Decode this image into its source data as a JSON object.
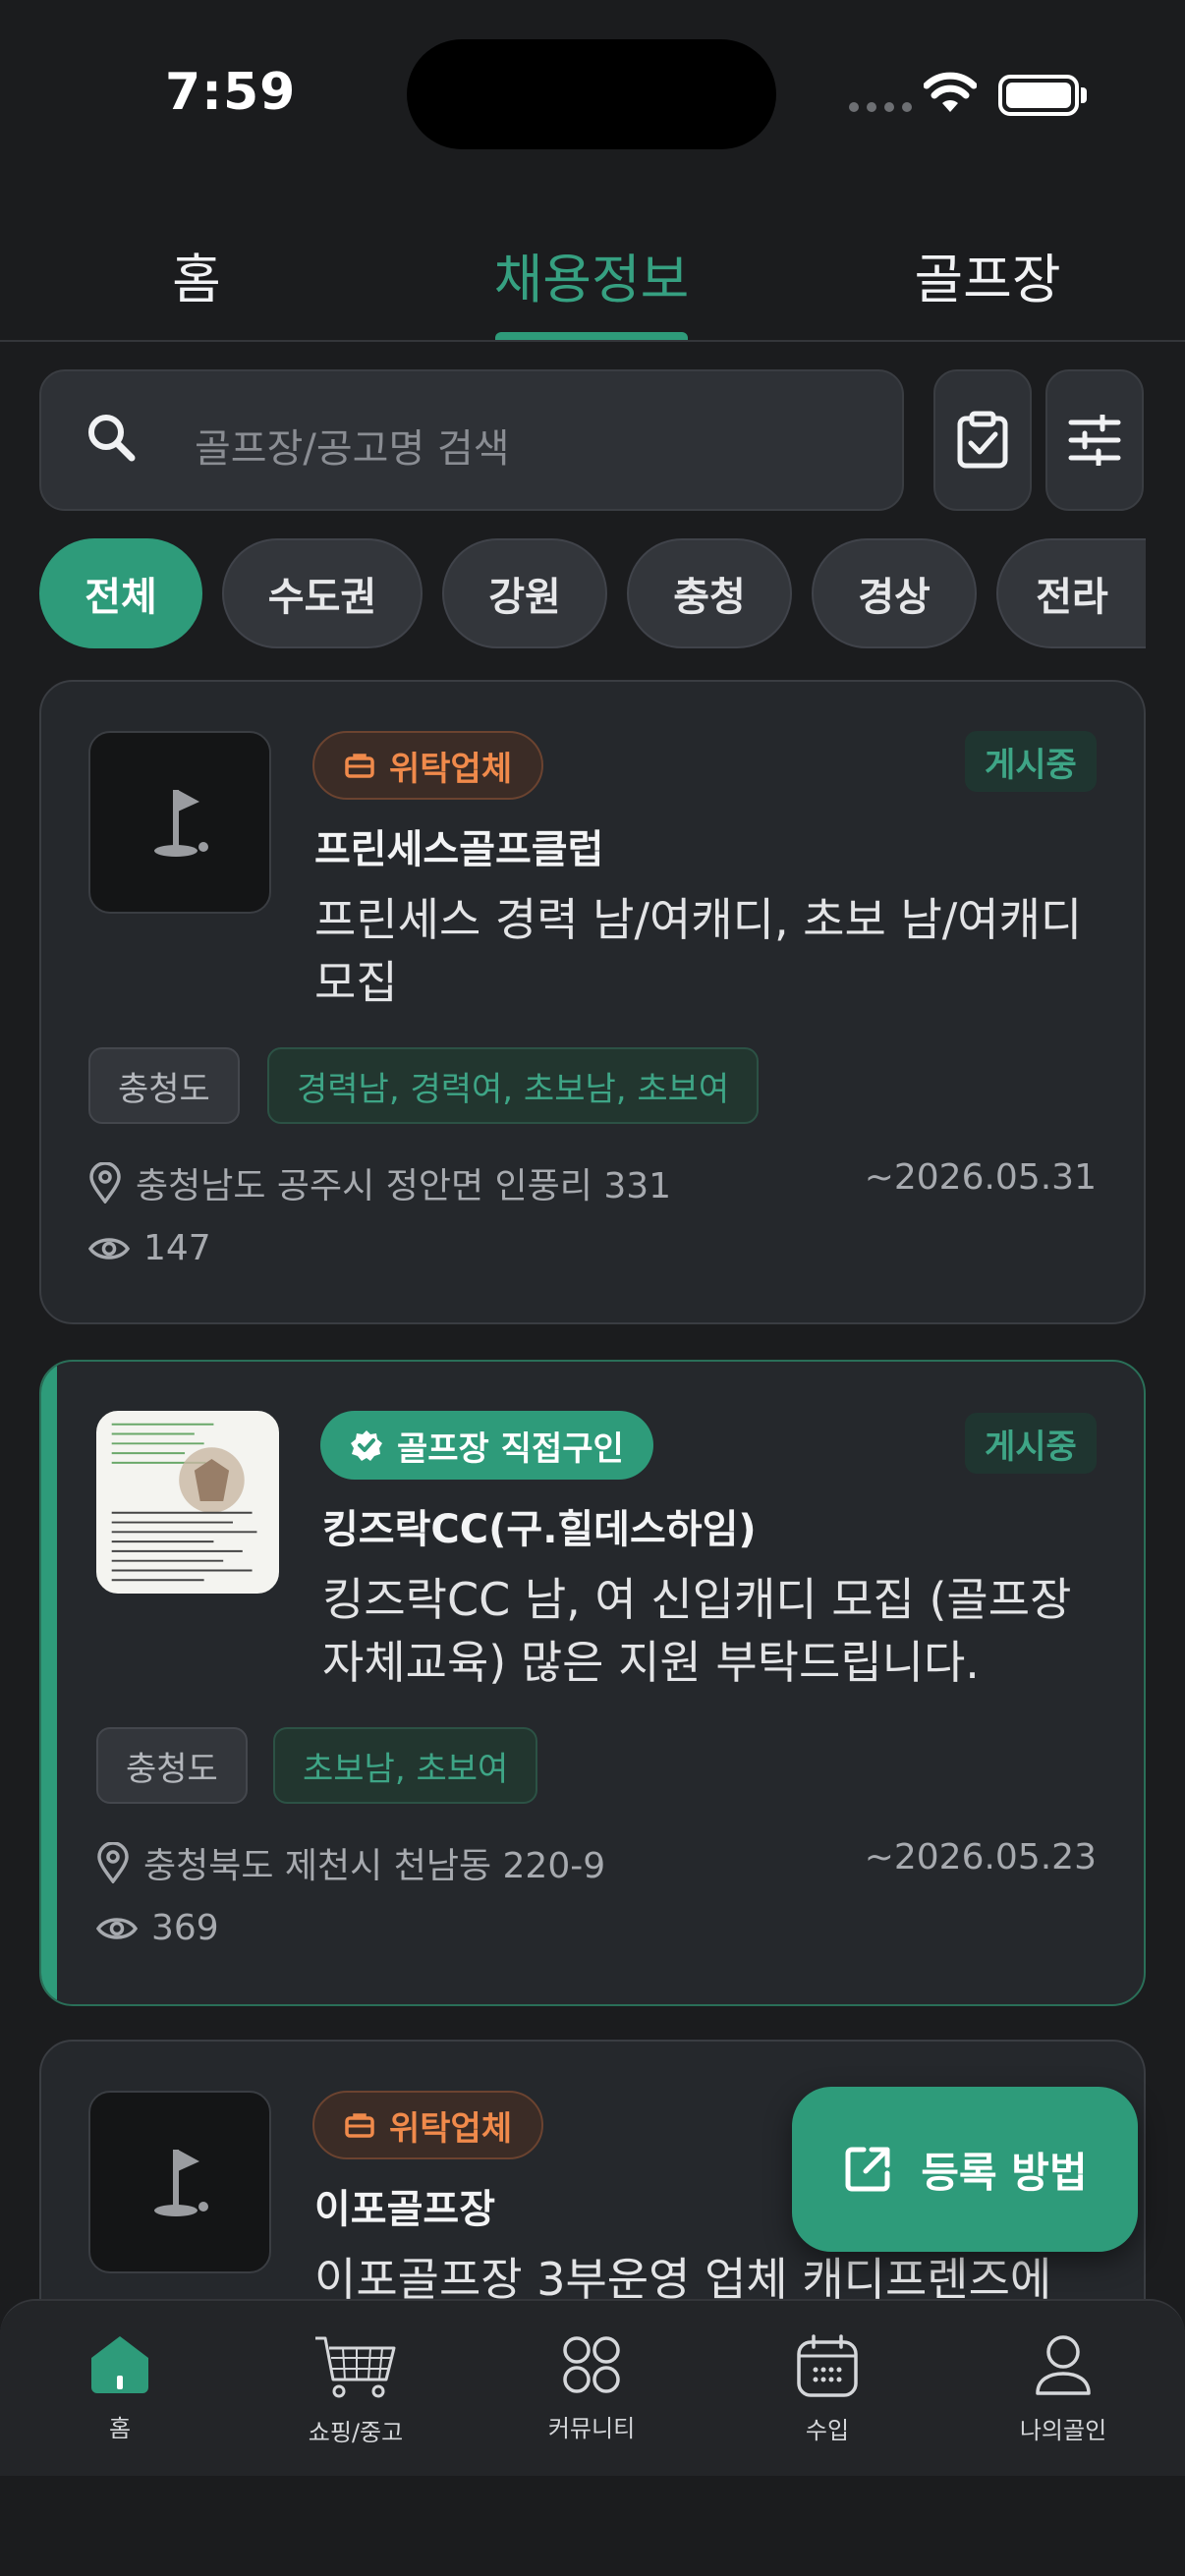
{
  "status_bar": {
    "time": "7:59"
  },
  "top_tabs": [
    {
      "label": "홈",
      "active": false
    },
    {
      "label": "채용정보",
      "active": true
    },
    {
      "label": "골프장",
      "active": false
    }
  ],
  "search": {
    "placeholder": "골프장/공고명 검색"
  },
  "region_chips": [
    {
      "label": "전체",
      "active": true
    },
    {
      "label": "수도권",
      "active": false
    },
    {
      "label": "강원",
      "active": false
    },
    {
      "label": "충청",
      "active": false
    },
    {
      "label": "경상",
      "active": false
    },
    {
      "label": "전라",
      "active": false
    }
  ],
  "cards": [
    {
      "type_badge": "위탁업체",
      "status": "게시중",
      "club_name": "프린세스골프클럽",
      "title_line1": "프린세스 경력 남/여캐디, 초보 남/여캐디",
      "title_line2": "모집",
      "region_tag": "충청도",
      "types_tag": "경력남, 경력여, 초보남, 초보여",
      "address": "충청남도 공주시 정안면 인풍리 331",
      "deadline": "~2026.05.31",
      "views": "147"
    },
    {
      "type_badge": "골프장 직접구인",
      "status": "게시중",
      "club_name": "킹즈락CC(구.힐데스하임)",
      "title_line1": "킹즈락CC 남, 여 신입캐디 모집 (골프장",
      "title_line2": "자체교육) 많은 지원 부탁드립니다.",
      "region_tag": "충청도",
      "types_tag": "초보남, 초보여",
      "address": "충청북도 제천시 천남동 220-9",
      "deadline": "~2026.05.23",
      "views": "369"
    },
    {
      "type_badge": "위탁업체",
      "club_name": "이포골프장",
      "title_line1": "이포골프장 3부운영 업체 캐디프렌즈에"
    }
  ],
  "fab": {
    "label": "등록 방법"
  },
  "bottom_nav": [
    {
      "label": "홈",
      "icon": "home-icon"
    },
    {
      "label": "쇼핑/중고",
      "icon": "cart-icon"
    },
    {
      "label": "커뮤니티",
      "icon": "grid-icon"
    },
    {
      "label": "수입",
      "icon": "calendar-icon"
    },
    {
      "label": "나의골인",
      "icon": "person-icon"
    }
  ],
  "colors": {
    "accent": "#2e9b7a",
    "agency": "#f08a4b",
    "background": "#1b1c1e",
    "card": "#25282c"
  }
}
